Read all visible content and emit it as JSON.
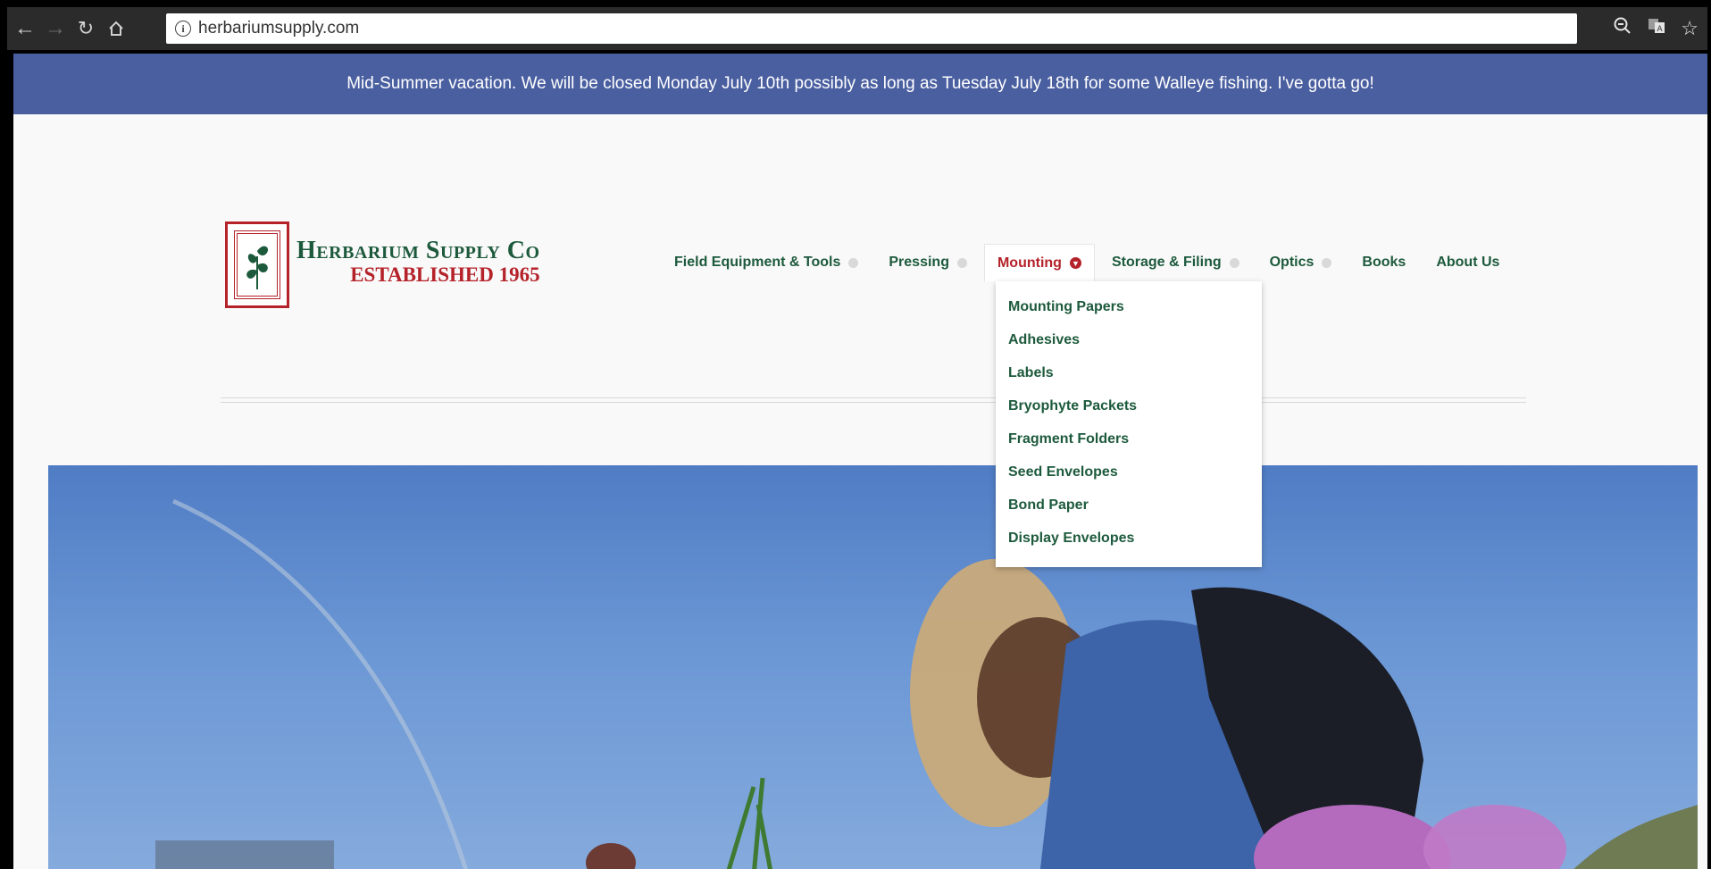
{
  "browser": {
    "url": "herbariumsupply.com",
    "back_icon": "arrow-left",
    "forward_icon": "arrow-right",
    "reload_icon": "reload",
    "home_icon": "home",
    "zoom_icon": "zoom-out",
    "translate_icon": "translate",
    "bookmark_icon": "star"
  },
  "banner": {
    "text": "Mid-Summer vacation. We will be closed Monday July 10th possibly as long as Tuesday July 18th for some Walleye fishing. I've gotta go!",
    "background": "#4a5fa0"
  },
  "logo": {
    "title": "Herbarium Supply Co",
    "subtitle": "ESTABLISHED 1965",
    "title_color": "#1d5a3c",
    "accent_color": "#b5222a"
  },
  "menu": {
    "items": [
      {
        "label": "Field Equipment & Tools"
      },
      {
        "label": "Pressing"
      },
      {
        "label": "Mounting"
      },
      {
        "label": "Storage & Filing"
      },
      {
        "label": "Optics"
      },
      {
        "label": "Books"
      },
      {
        "label": "About Us"
      }
    ],
    "active_index": 2
  },
  "dropdown": {
    "items": [
      {
        "label": "Mounting Papers"
      },
      {
        "label": "Adhesives"
      },
      {
        "label": "Labels"
      },
      {
        "label": "Bryophyte Packets"
      },
      {
        "label": "Fragment Folders"
      },
      {
        "label": "Seed Envelopes"
      },
      {
        "label": "Bond Paper"
      },
      {
        "label": "Display Envelopes"
      }
    ]
  }
}
